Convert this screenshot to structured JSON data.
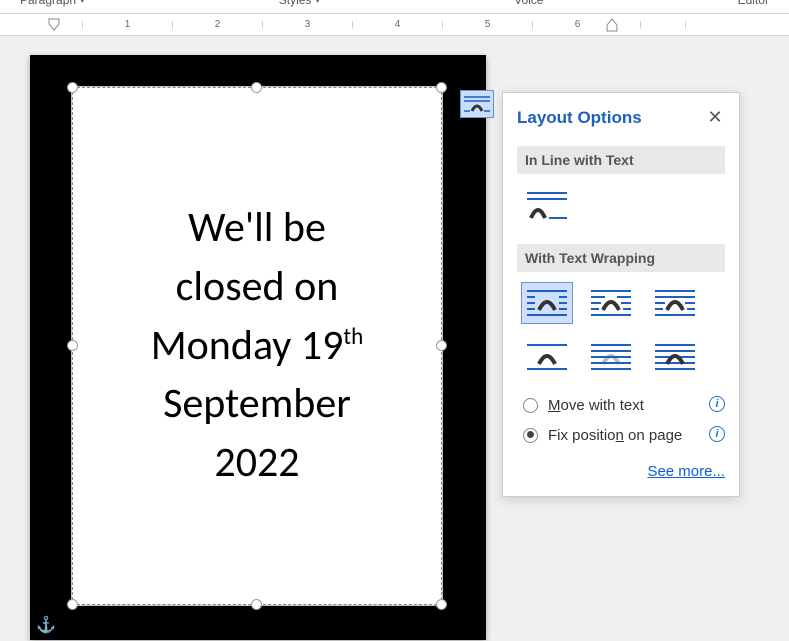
{
  "ribbon": {
    "groups": [
      "Paragraph",
      "Styles",
      "Voice",
      "Editor"
    ]
  },
  "ruler": {
    "ticks": [
      "1",
      "2",
      "3",
      "4",
      "5",
      "6"
    ]
  },
  "textbox": {
    "line1": "We'll be",
    "line2": "closed on",
    "line3_pre": "Monday 19",
    "line3_sup": "th",
    "line4": "September",
    "line5": "2022"
  },
  "layout_panel": {
    "title": "Layout Options",
    "inline_label": "In Line with Text",
    "wrap_label": "With Text Wrapping",
    "radio_move_pre": "M",
    "radio_move_rest": "ove with text",
    "radio_fix_pre": "Fix positio",
    "radio_fix_u": "n",
    "radio_fix_rest": " on page",
    "see_more": "See more..."
  }
}
